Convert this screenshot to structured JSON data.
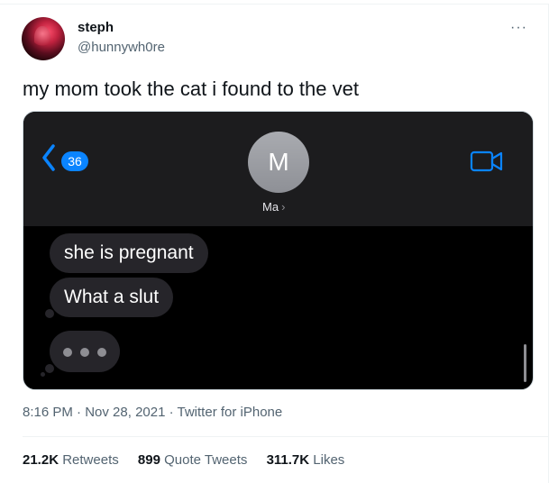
{
  "user": {
    "name": "steph",
    "handle": "@hunnywh0re"
  },
  "more_label": "···",
  "tweet_text": "my mom took the cat i found to the vet",
  "screenshot": {
    "back_count": "36",
    "contact_initial": "M",
    "contact_name": "Ma",
    "contact_chevron": "›",
    "messages": [
      {
        "text": "she is pregnant"
      },
      {
        "text": "What a slut"
      }
    ],
    "colors": {
      "header_bg": "#1c1c1e",
      "bubble_bg": "#26252a",
      "ios_blue": "#0a84ff"
    }
  },
  "meta": {
    "time": "8:16 PM",
    "separator": " · ",
    "date": "Nov 28, 2021",
    "source": "Twitter for iPhone"
  },
  "stats": {
    "retweets_count": "21.2K",
    "retweets_label": "Retweets",
    "quotes_count": "899",
    "quotes_label": "Quote Tweets",
    "likes_count": "311.7K",
    "likes_label": "Likes"
  }
}
